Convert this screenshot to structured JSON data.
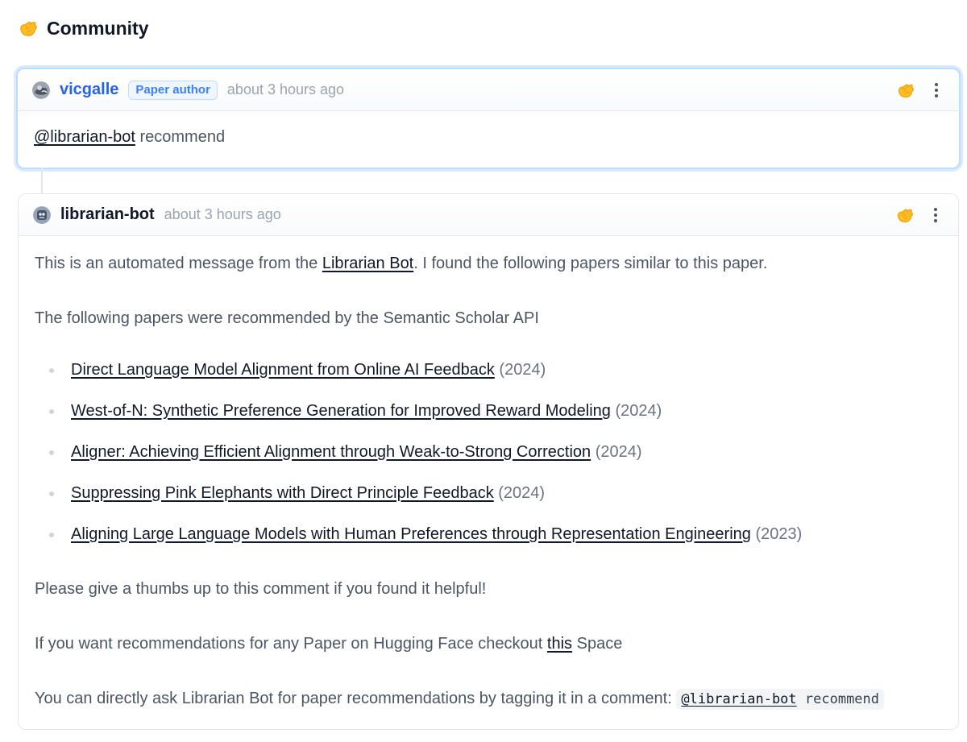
{
  "section": {
    "title": "Community",
    "icon": "hugging-hand-icon"
  },
  "comments": [
    {
      "username": "vicgalle",
      "badge": "Paper author",
      "timestamp": "about 3 hours ago",
      "mention": "@librarian-bot",
      "text": " recommend"
    },
    {
      "username": "librarian-bot",
      "timestamp": "about 3 hours ago",
      "intro_before": "This is an automated message from the ",
      "intro_link": "Librarian Bot",
      "intro_after": ". I found the following papers similar to this paper.",
      "recommended_heading": "The following papers were recommended by the Semantic Scholar API",
      "papers": [
        {
          "title": "Direct Language Model Alignment from Online AI Feedback",
          "year": " (2024)"
        },
        {
          "title": "West-of-N: Synthetic Preference Generation for Improved Reward Modeling",
          "year": " (2024)"
        },
        {
          "title": "Aligner: Achieving Efficient Alignment through Weak-to-Strong Correction",
          "year": " (2024)"
        },
        {
          "title": "Suppressing Pink Elephants with Direct Principle Feedback",
          "year": " (2024)"
        },
        {
          "title": "Aligning Large Language Models with Human Preferences through Representation Engineering",
          "year": " (2023)"
        }
      ],
      "thumbs_up_text": "Please give a thumbs up to this comment if you found it helpful!",
      "checkout_before": "If you want recommendations for any Paper on Hugging Face checkout ",
      "checkout_link": "this",
      "checkout_after": " Space",
      "tag_text": "You can directly ask Librarian Bot for paper recommendations by tagging it in a comment: ",
      "tag_code_mention": "@librarian-bot",
      "tag_code_rest": " recommend"
    }
  ],
  "colors": {
    "accent_blue": "#2563eb",
    "highlight_border": "#bfdbfe",
    "hand_yellow": "#fbbf24"
  }
}
